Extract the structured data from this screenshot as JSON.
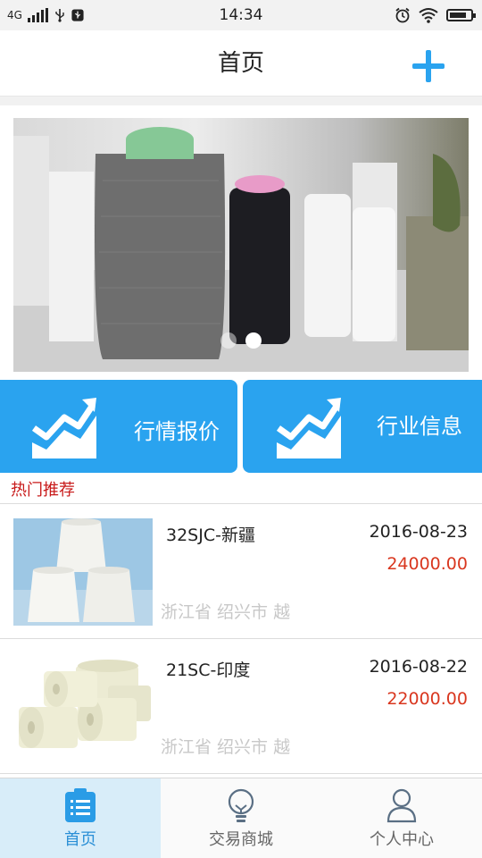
{
  "status_bar": {
    "network": "4G",
    "time": "14:34"
  },
  "header": {
    "title": "首页",
    "add_icon": "plus-icon"
  },
  "banner": {
    "image": "yarn-spools-photo",
    "slide_count": 2,
    "active_slide": 2
  },
  "quick_tiles": [
    {
      "label": "行情报价",
      "icon": "trend-chart-icon"
    },
    {
      "label": "行业信息",
      "icon": "trend-chart-icon"
    }
  ],
  "section": {
    "title": "热门推荐"
  },
  "products": [
    {
      "name": "32SJC-新疆",
      "date": "2016-08-23",
      "price": "24000.00",
      "location": "浙江省 绍兴市 越"
    },
    {
      "name": "21SC-印度",
      "date": "2016-08-22",
      "price": "22000.00",
      "location": "浙江省 绍兴市 越"
    }
  ],
  "bottom_nav": [
    {
      "label": "首页",
      "icon": "document-list-icon",
      "active": true
    },
    {
      "label": "交易商城",
      "icon": "lightbulb-icon",
      "active": false
    },
    {
      "label": "个人中心",
      "icon": "person-icon",
      "active": false
    }
  ],
  "colors": {
    "accent": "#2aa3ef",
    "section_title": "#c81a1a",
    "price": "#d9371f"
  }
}
